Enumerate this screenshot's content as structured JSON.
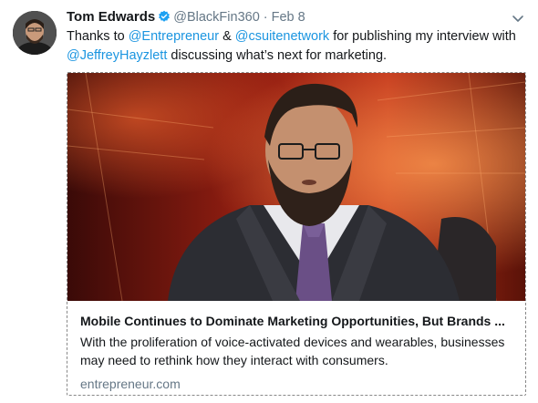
{
  "tweet": {
    "author_name": "Tom Edwards",
    "handle": "@BlackFin360",
    "separator": "·",
    "date": "Feb 8",
    "text_parts": [
      {
        "text": "Thanks to ",
        "type": "text"
      },
      {
        "text": "@Entrepreneur",
        "type": "link"
      },
      {
        "text": " & ",
        "type": "text"
      },
      {
        "text": "@csuitenetwork",
        "type": "link"
      },
      {
        "text": " for publishing my interview with",
        "type": "text"
      },
      {
        "text": "@JeffreyHayzlett",
        "type": "link"
      },
      {
        "text": " discussing what’s next for marketing.",
        "type": "text"
      }
    ]
  },
  "card": {
    "title": "Mobile Continues to Dominate Marketing Opportunities, But Brands ...",
    "description": "With the proliferation of voice-activated devices and wearables, businesses may need to rethink how they interact with consumers.",
    "domain": "entrepreneur.com"
  },
  "icons": {
    "verified": "verified-badge-icon",
    "caret": "chevron-down-icon"
  },
  "colors": {
    "link": "#1b95e0",
    "secondary_text": "#657786",
    "verified": "#1da1f2"
  }
}
